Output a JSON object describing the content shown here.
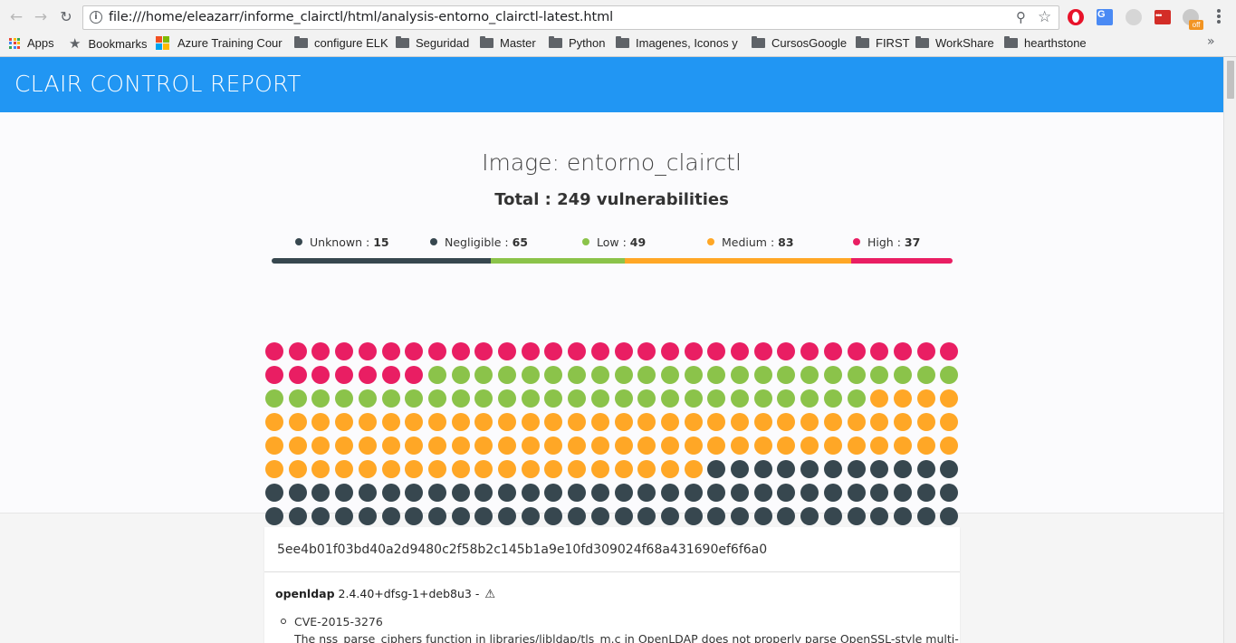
{
  "browser": {
    "url": "file:///home/eleazarr/informe_clairctl/html/analysis-entorno_clairctl-latest.html",
    "ext_badge": "off",
    "bookmarks": [
      {
        "label": "Apps",
        "icon": "apps-icon"
      },
      {
        "label": "Bookmarks",
        "icon": "star-icon"
      },
      {
        "label": "Azure Training Cour",
        "icon": "microsoft-icon"
      },
      {
        "label": "configure ELK",
        "icon": "folder-icon"
      },
      {
        "label": "Seguridad",
        "icon": "folder-icon"
      },
      {
        "label": "Master",
        "icon": "folder-icon"
      },
      {
        "label": "Python",
        "icon": "folder-icon"
      },
      {
        "label": "Imagenes, Iconos y",
        "icon": "folder-icon"
      },
      {
        "label": "CursosGoogle",
        "icon": "folder-icon"
      },
      {
        "label": "FIRST",
        "icon": "folder-icon"
      },
      {
        "label": "WorkShare",
        "icon": "folder-icon"
      },
      {
        "label": "hearthstone",
        "icon": "folder-icon"
      }
    ],
    "more_label": "»"
  },
  "report": {
    "header_title": "CLAIR CONTROL REPORT",
    "image_title": "Image: entorno_clairctl",
    "total_text": "Total : 249 vulnerabilities",
    "colors": {
      "Unknown": "#37474f",
      "Negligible": "#37474f",
      "Low": "#8bc34a",
      "Medium": "#ffa726",
      "High": "#e91e63"
    },
    "legend": [
      {
        "name": "Unknown",
        "label": "Unknown : ",
        "count": 15
      },
      {
        "name": "Negligible",
        "label": "Negligible : ",
        "count": 65
      },
      {
        "name": "Low",
        "label": "Low : ",
        "count": 49
      },
      {
        "name": "Medium",
        "label": "Medium : ",
        "count": 83
      },
      {
        "name": "High",
        "label": "High : ",
        "count": 37
      }
    ],
    "dot_order": [
      "High",
      "Low",
      "Medium",
      "Negligible",
      "Unknown"
    ]
  },
  "layer": {
    "hash": "5ee4b01f03bd40a2d9480c2f58b2c145b1a9e10fd309024f68a431690ef6f6a0",
    "package_name": "openldap",
    "package_version": "2.4.40+dfsg-1+deb8u3 -",
    "warning_icon": "warning-icon",
    "cve_id": "CVE-2015-3276",
    "cve_description": "The nss_parse_ciphers function in libraries/libldap/tls_m.c in OpenLDAP does not properly parse OpenSSL-style multi-"
  }
}
